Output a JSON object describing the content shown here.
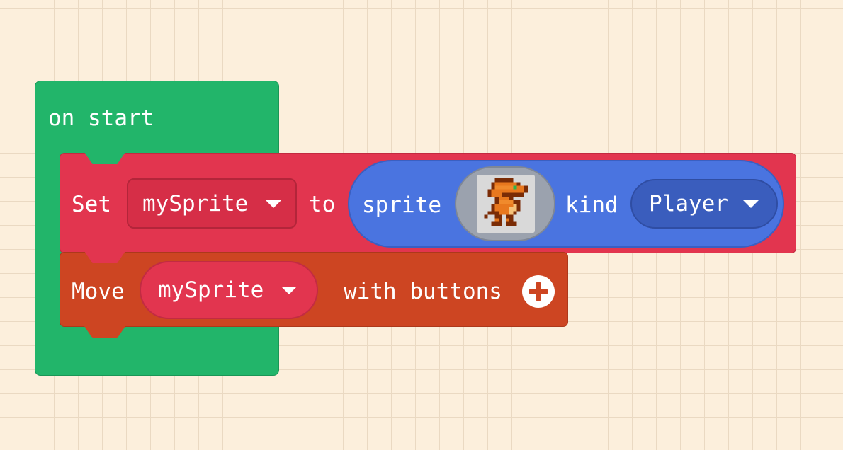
{
  "colors": {
    "workspace_background": "#fcefdc",
    "event_block": "#22b56a",
    "sprite_set_block": "#e2354f",
    "sprite_block": "#4a74e0",
    "controller_block": "#cd4522",
    "text": "#ffffff"
  },
  "on_start": {
    "label": "on start",
    "icon": "event-hat"
  },
  "set_block": {
    "set_label": "Set",
    "variable": "mySprite",
    "to_label": "to",
    "caret_icon": "triangle-down-icon",
    "sprite_create": {
      "sprite_label": "sprite",
      "image": "orange-dinosaur-pixel-art",
      "kind_label": "kind",
      "kind_value": "Player"
    }
  },
  "move_block": {
    "move_label": "Move",
    "variable": "mySprite",
    "with_buttons_label": "with buttons",
    "expand_icon": "plus-circle-icon"
  }
}
